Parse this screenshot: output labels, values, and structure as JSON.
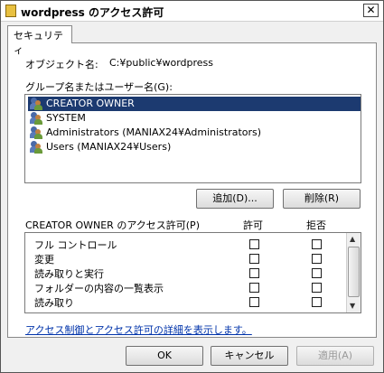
{
  "window": {
    "title": "wordpress のアクセス許可",
    "close_glyph": "✕"
  },
  "tabs": [
    {
      "label": "セキュリティ"
    }
  ],
  "object": {
    "label": "オブジェクト名:",
    "value": "C:¥public¥wordpress"
  },
  "group_list": {
    "label": "グループ名またはユーザー名(G):",
    "items": [
      {
        "name": "CREATOR OWNER",
        "selected": true,
        "icon": "user-group-icon"
      },
      {
        "name": "SYSTEM",
        "selected": false,
        "icon": "user-group-icon"
      },
      {
        "name": "Administrators (MANIAX24¥Administrators)",
        "selected": false,
        "icon": "user-group-icon"
      },
      {
        "name": "Users (MANIAX24¥Users)",
        "selected": false,
        "icon": "user-group-icon"
      }
    ]
  },
  "buttons": {
    "add": "追加(D)...",
    "remove": "削除(R)",
    "ok": "OK",
    "cancel": "キャンセル",
    "apply": "適用(A)"
  },
  "permissions": {
    "label": "CREATOR OWNER のアクセス許可(P)",
    "allow_header": "許可",
    "deny_header": "拒否",
    "rows": [
      {
        "name": "フル コントロール",
        "allow": false,
        "deny": false
      },
      {
        "name": "変更",
        "allow": false,
        "deny": false
      },
      {
        "name": "読み取りと実行",
        "allow": false,
        "deny": false
      },
      {
        "name": "フォルダーの内容の一覧表示",
        "allow": false,
        "deny": false
      },
      {
        "name": "読み取り",
        "allow": false,
        "deny": false
      }
    ]
  },
  "link_text": "アクセス制御とアクセス許可の詳細を表示します。",
  "colors": {
    "selection": "#1c3a70",
    "link": "#0033aa"
  }
}
